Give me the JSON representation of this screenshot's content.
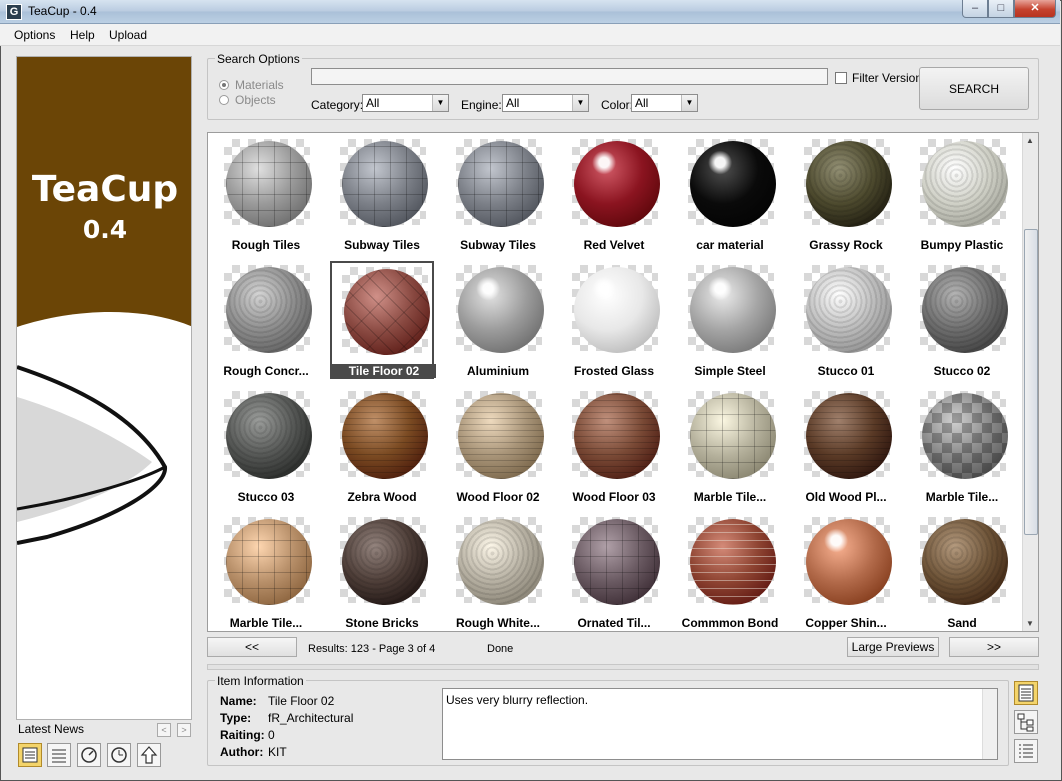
{
  "window": {
    "title": "TeaCup - 0.4",
    "app_icon_glyph": "G"
  },
  "menu": [
    "Options",
    "Help",
    "Upload"
  ],
  "banner": {
    "name": "TeaCup",
    "version": "0.4",
    "brown": "#6b4506"
  },
  "news": {
    "label": "Latest News",
    "prev": "<",
    "next": ">"
  },
  "search": {
    "legend": "Search Options",
    "radio_materials": "Materials",
    "radio_objects": "Objects",
    "query": "",
    "filter_label": "Filter Version",
    "button": "SEARCH",
    "category_label": "Category:",
    "category_value": "All",
    "engine_label": "Engine:",
    "engine_value": "All",
    "color_label": "Color:",
    "color_value": "All"
  },
  "tiles": [
    {
      "label": "Rough Tiles",
      "color": "#9a9a9a",
      "kind": "grid"
    },
    {
      "label": "Subway Tiles",
      "color": "#7c8088",
      "kind": "grid"
    },
    {
      "label": "Subway Tiles",
      "color": "#7c8088",
      "kind": "grid"
    },
    {
      "label": "Red Velvet",
      "color": "#8b1420",
      "kind": "glossy"
    },
    {
      "label": "car material",
      "color": "#0a0a0a",
      "kind": "glossy"
    },
    {
      "label": "Grassy Rock",
      "color": "#4d4a2e",
      "kind": "rough"
    },
    {
      "label": "Bumpy Plastic",
      "color": "#cfd0c6",
      "kind": "rough"
    },
    {
      "label": "Rough Concr...",
      "color": "#8e8e8e",
      "kind": "rough"
    },
    {
      "label": "Tile Floor 02",
      "color": "#8a4a42",
      "kind": "herring",
      "selected": true
    },
    {
      "label": "Aluminium",
      "color": "#9c9c9c",
      "kind": "glossy"
    },
    {
      "label": "Frosted Glass",
      "color": "#e8e8e8",
      "kind": "glossy"
    },
    {
      "label": "Simple Steel",
      "color": "#a5a5a5",
      "kind": "glossy"
    },
    {
      "label": "Stucco 01",
      "color": "#bdbdbd",
      "kind": "rough"
    },
    {
      "label": "Stucco 02",
      "color": "#6e6e6e",
      "kind": "rough"
    },
    {
      "label": "Stucco 03",
      "color": "#555755",
      "kind": "rough"
    },
    {
      "label": "Zebra Wood",
      "color": "#7a4a22",
      "kind": "wood"
    },
    {
      "label": "Wood Floor 02",
      "color": "#a89478",
      "kind": "wood"
    },
    {
      "label": "Wood Floor 03",
      "color": "#7a4a36",
      "kind": "wood"
    },
    {
      "label": "Marble Tile...",
      "color": "#b5b19c",
      "kind": "grid"
    },
    {
      "label": "Old Wood Pl...",
      "color": "#5a3a26",
      "kind": "wood"
    },
    {
      "label": "Marble Tile...",
      "color": "#8a8a8a",
      "kind": "checker"
    },
    {
      "label": "Marble Tile...",
      "color": "#b8906a",
      "kind": "grid"
    },
    {
      "label": "Stone Bricks",
      "color": "#4e3e38",
      "kind": "rough"
    },
    {
      "label": "Rough White...",
      "color": "#b6b0a2",
      "kind": "rough"
    },
    {
      "label": "Ornated Til...",
      "color": "#6a5a62",
      "kind": "grid"
    },
    {
      "label": "Commmon Bond",
      "color": "#8e4432",
      "kind": "brick"
    },
    {
      "label": "Copper Shin...",
      "color": "#b26a4a",
      "kind": "glossy"
    },
    {
      "label": "Sand",
      "color": "#6e5438",
      "kind": "rough"
    }
  ],
  "paging": {
    "prev": "<<",
    "next": ">>",
    "results": "Results: 123 - Page 3 of 4",
    "status": "Done",
    "large_previews": "Large Previews"
  },
  "item_info": {
    "legend": "Item Information",
    "name_key": "Name:",
    "name_val": "Tile Floor 02",
    "type_key": "Type:",
    "type_val": "fR_Architectural",
    "rating_key": "Raiting:",
    "rating_val": "0",
    "author_key": "Author:",
    "author_val": "KIT",
    "description": "Uses very blurry reflection."
  }
}
